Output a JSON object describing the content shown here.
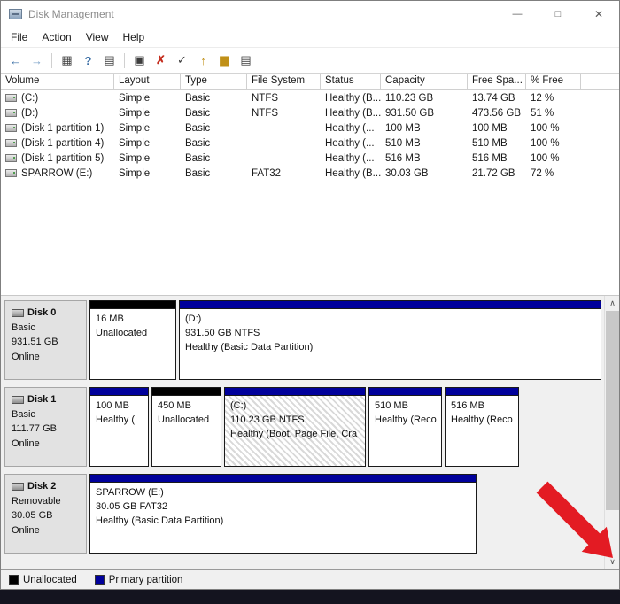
{
  "window": {
    "title": "Disk Management",
    "controls": {
      "minimize": "—",
      "maximize": "□",
      "close": "✕"
    }
  },
  "menu": {
    "items": [
      "File",
      "Action",
      "View",
      "Help"
    ]
  },
  "toolbar": {
    "icons": [
      {
        "name": "back",
        "glyph": "←"
      },
      {
        "name": "forward",
        "glyph": "→"
      },
      {
        "name": "show-console-tree",
        "glyph": "▦"
      },
      {
        "name": "help",
        "glyph": "?"
      },
      {
        "name": "export-list",
        "glyph": "▤"
      },
      {
        "name": "properties",
        "glyph": "▣"
      },
      {
        "name": "delete-volume",
        "glyph": "✗"
      },
      {
        "name": "mark-partition-active",
        "glyph": "✓"
      },
      {
        "name": "extend-volume",
        "glyph": "↑"
      },
      {
        "name": "open-folder",
        "glyph": "▆"
      },
      {
        "name": "attributes",
        "glyph": "▤"
      }
    ]
  },
  "volume_list": {
    "columns": [
      "Volume",
      "Layout",
      "Type",
      "File System",
      "Status",
      "Capacity",
      "Free Spa...",
      "% Free"
    ],
    "rows": [
      {
        "volume": "(C:)",
        "layout": "Simple",
        "type": "Basic",
        "fs": "NTFS",
        "status": "Healthy (B...",
        "capacity": "110.23 GB",
        "free": "13.74 GB",
        "pct": "12 %"
      },
      {
        "volume": "(D:)",
        "layout": "Simple",
        "type": "Basic",
        "fs": "NTFS",
        "status": "Healthy (B...",
        "capacity": "931.50 GB",
        "free": "473.56 GB",
        "pct": "51 %"
      },
      {
        "volume": "(Disk 1 partition 1)",
        "layout": "Simple",
        "type": "Basic",
        "fs": "",
        "status": "Healthy (...",
        "capacity": "100 MB",
        "free": "100 MB",
        "pct": "100 %"
      },
      {
        "volume": "(Disk 1 partition 4)",
        "layout": "Simple",
        "type": "Basic",
        "fs": "",
        "status": "Healthy (...",
        "capacity": "510 MB",
        "free": "510 MB",
        "pct": "100 %"
      },
      {
        "volume": "(Disk 1 partition 5)",
        "layout": "Simple",
        "type": "Basic",
        "fs": "",
        "status": "Healthy (...",
        "capacity": "516 MB",
        "free": "516 MB",
        "pct": "100 %"
      },
      {
        "volume": "SPARROW (E:)",
        "layout": "Simple",
        "type": "Basic",
        "fs": "FAT32",
        "status": "Healthy (B...",
        "capacity": "30.03 GB",
        "free": "21.72 GB",
        "pct": "72 %"
      }
    ]
  },
  "disks": [
    {
      "name": "Disk 0",
      "kind": "Basic",
      "size": "931.51 GB",
      "status": "Online",
      "partitions": [
        {
          "line1": "16 MB",
          "line2": "Unallocated",
          "line3": ""
        },
        {
          "line1": "(D:)",
          "line2": "931.50 GB NTFS",
          "line3": "Healthy (Basic Data Partition)"
        }
      ]
    },
    {
      "name": "Disk 1",
      "kind": "Basic",
      "size": "111.77 GB",
      "status": "Online",
      "partitions": [
        {
          "line1": "100 MB",
          "line2": "Healthy (",
          "line3": ""
        },
        {
          "line1": "450 MB",
          "line2": "Unallocated",
          "line3": ""
        },
        {
          "line1": "(C:)",
          "line2": "110.23 GB NTFS",
          "line3": "Healthy (Boot, Page File, Cra"
        },
        {
          "line1": "510 MB",
          "line2": "Healthy (Reco",
          "line3": ""
        },
        {
          "line1": "516 MB",
          "line2": "Healthy (Reco",
          "line3": ""
        }
      ]
    },
    {
      "name": "Disk 2",
      "kind": "Removable",
      "size": "30.05 GB",
      "status": "Online",
      "partitions": [
        {
          "line1": "SPARROW  (E:)",
          "line2": "30.05 GB FAT32",
          "line3": "Healthy (Basic Data Partition)"
        }
      ]
    }
  ],
  "legend": {
    "items": [
      {
        "label": "Unallocated",
        "color": "#000000"
      },
      {
        "label": "Primary partition",
        "color": "#00009b"
      }
    ]
  },
  "scrollbar": {
    "up": "∧",
    "down": "∨"
  },
  "colors": {
    "primary_partition": "#00009b",
    "unallocated": "#000000",
    "annotation_arrow": "#e31b23",
    "titlebar_text": "#8b8b8b"
  }
}
